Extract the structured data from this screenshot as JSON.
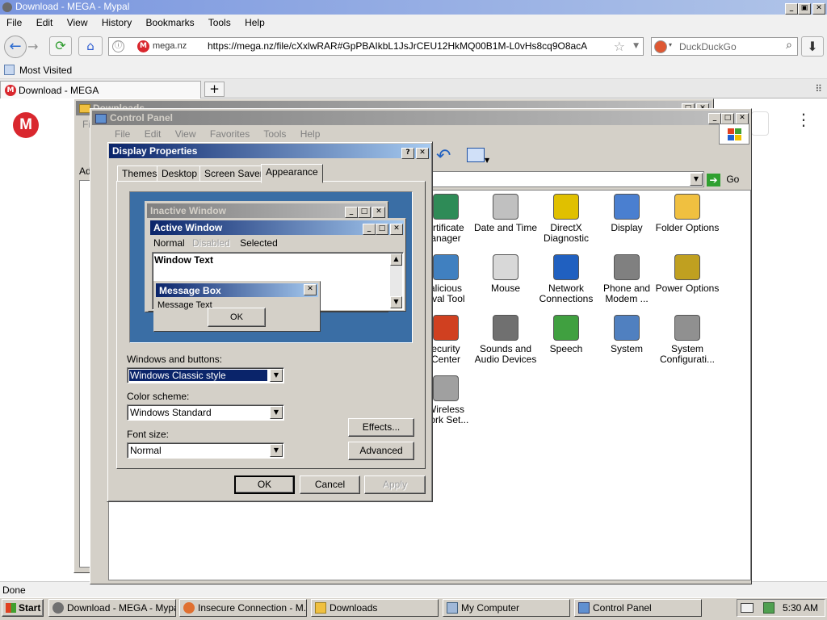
{
  "browser": {
    "title": "Download - MEGA - Mypal",
    "menu": [
      "File",
      "Edit",
      "View",
      "History",
      "Bookmarks",
      "Tools",
      "Help"
    ],
    "site_label": "mega.nz",
    "url": "https://mega.nz/file/cXxlwRAR#GpPBAIkbL1JsJrCEU12HkMQ00B1M-L0vHs8cq9O8acA",
    "search_placeholder": "DuckDuckGo",
    "bookmark": "Most Visited",
    "tab_title": "Download - MEGA",
    "status": "Done"
  },
  "downloads_window": {
    "title": "Downloads"
  },
  "control_panel": {
    "title": "Control Panel",
    "menu": [
      "File",
      "Edit",
      "View",
      "Favorites",
      "Tools",
      "Help"
    ],
    "go_label": "Go",
    "items": [
      {
        "label": "ertificate\nanager",
        "icon": "certificate-icon",
        "color": "#2e8b57"
      },
      {
        "label": "Date and Time",
        "icon": "clock-icon",
        "color": "#c0c0c0"
      },
      {
        "label": "DirectX\nDiagnostic",
        "icon": "directx-icon",
        "color": "#e0c000"
      },
      {
        "label": "Display",
        "icon": "display-icon",
        "color": "#4a7fd0"
      },
      {
        "label": "Folder Options",
        "icon": "folder-icon",
        "color": "#f0c040"
      },
      {
        "label": "alicious\noval Tool",
        "icon": "malware-tool-icon",
        "color": "#4080c0"
      },
      {
        "label": "Mouse",
        "icon": "mouse-icon",
        "color": "#d8d8d8"
      },
      {
        "label": "Network\nConnections",
        "icon": "network-icon",
        "color": "#2060c0"
      },
      {
        "label": "Phone and\nModem ...",
        "icon": "phone-icon",
        "color": "#808080"
      },
      {
        "label": "Power Options",
        "icon": "power-icon",
        "color": "#c0a020"
      },
      {
        "label": "ecurity\nCenter",
        "icon": "shield-icon",
        "color": "#d04020"
      },
      {
        "label": "Sounds and\nAudio Devices",
        "icon": "speaker-icon",
        "color": "#707070"
      },
      {
        "label": "Speech",
        "icon": "speech-icon",
        "color": "#40a040"
      },
      {
        "label": "System",
        "icon": "computer-icon",
        "color": "#5080c0"
      },
      {
        "label": "System\nConfigurati...",
        "icon": "system-config-icon",
        "color": "#909090"
      },
      {
        "label": "Wireless\nwork Set...",
        "icon": "wireless-icon",
        "color": "#a0a0a0"
      }
    ]
  },
  "display_properties": {
    "title": "Display Properties",
    "tabs": [
      "Themes",
      "Desktop",
      "Screen Saver",
      "Appearance"
    ],
    "preview": {
      "inactive_title": "Inactive Window",
      "active_title": "Active Window",
      "menu_normal": "Normal",
      "menu_disabled": "Disabled",
      "menu_selected": "Selected",
      "window_text": "Window Text",
      "msgbox_title": "Message Box",
      "msgbox_text": "Message Text",
      "msgbox_ok": "OK"
    },
    "windows_buttons_label": "Windows and buttons:",
    "windows_buttons_value": "Windows Classic style",
    "color_scheme_label": "Color scheme:",
    "color_scheme_value": "Windows Standard",
    "font_size_label": "Font size:",
    "font_size_value": "Normal",
    "effects": "Effects...",
    "advanced": "Advanced",
    "ok": "OK",
    "cancel": "Cancel",
    "apply": "Apply"
  },
  "taskbar": {
    "start": "Start",
    "tasks": [
      "Download - MEGA - Mypal",
      "Insecure Connection - M...",
      "Downloads",
      "My Computer",
      "Control Panel"
    ],
    "clock": "5:30 AM"
  },
  "colors": {
    "mega_red": "#d9272e",
    "title_blue": "#0a246a",
    "desktop_bg": "#3a6ea5"
  }
}
